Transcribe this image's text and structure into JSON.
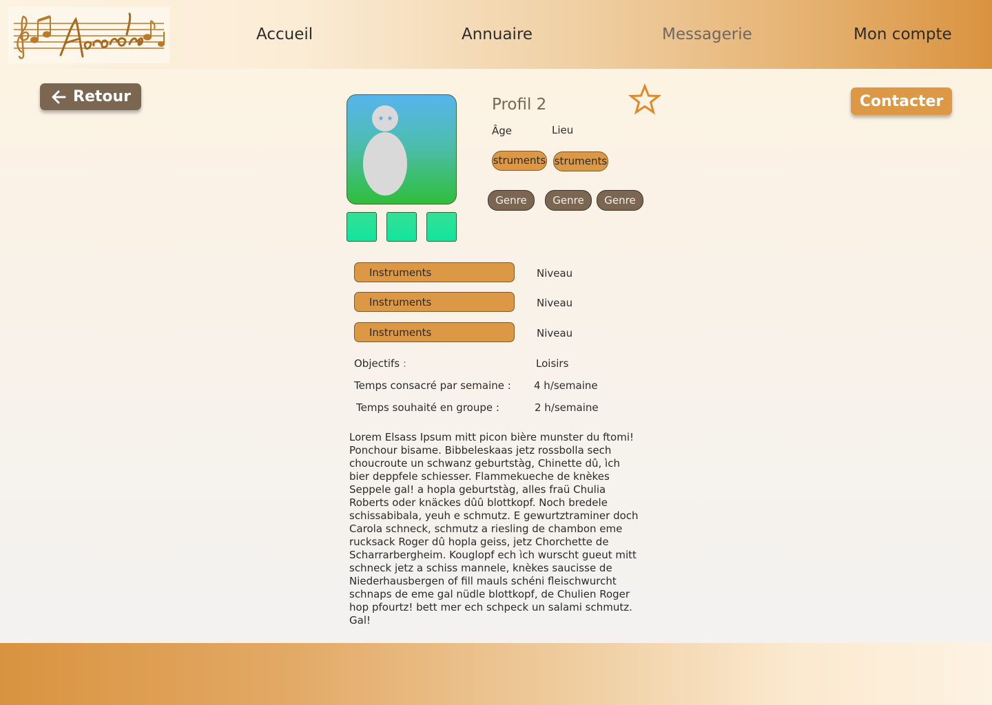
{
  "header": {
    "logo_text": "Accords",
    "nav": {
      "home": "Accueil",
      "directory": "Annuaire",
      "messages": "Messagerie",
      "account": "Mon compte"
    }
  },
  "actions": {
    "back_label": "Retour",
    "contact_label": "Contacter"
  },
  "profile": {
    "name": "Profil 2",
    "age_label": "Âge",
    "location_label": "Lieu",
    "instrument_tags": [
      "Instruments",
      "Instruments"
    ],
    "genres": [
      "Genre",
      "Genre",
      "Genre"
    ],
    "instruments": [
      {
        "name": "Instruments",
        "level": "Niveau"
      },
      {
        "name": "Instruments",
        "level": "Niveau"
      },
      {
        "name": "Instruments",
        "level": "Niveau"
      }
    ],
    "objectives_label": "Objectifs",
    "objectives_colon": ":",
    "objectives_value": "Loisirs",
    "weekly_time_label": "Temps consacré par semaine :",
    "weekly_time_value": "4 h/semaine",
    "group_time_label": "Temps souhaité en groupe :",
    "group_time_value": "2 h/semaine",
    "bio": "Lorem Elsass Ipsum mitt picon bière munster du ftomi!\nPonchour bisame.  Bibbeleskaas jetz rossbolla sech\nchoucroute un schwanz geburtstàg,  Chinette dû, ìch\nbier deppfele schiesser. Flammekueche de knèkes\nSeppele gal! a hopla geburtstàg, alles fraü Chulia\nRoberts oder knäckes dûû  blottkopf. Noch bredele\nschissabibala, yeuh e schmutz. E gewurtztraminer doch\nCarola schneck, schmutz a riesling de chambon eme\nrucksack Roger  dû hopla geiss, jetz Chorchette de\nScharrarbergheim. Kouglopf ech ìch  wurscht gueut mitt\nschneck jetz a schiss mannele, knèkes saucisse de\nNiederhausbergen of fill mauls schéni fleischwurcht\nschnaps de eme gal  nüdle blottkopf, de Chulien Roger\nhop pfourtz! bett mer ech schpeck un  salami schmutz.\nGal!"
  },
  "icons": {
    "back": "arrow-left-icon",
    "favorite": "star-outline-icon",
    "avatar": "user-placeholder-icon"
  },
  "colors": {
    "brown": "#7a6651",
    "orange": "#dc9845",
    "star": "#dc8a2a"
  }
}
